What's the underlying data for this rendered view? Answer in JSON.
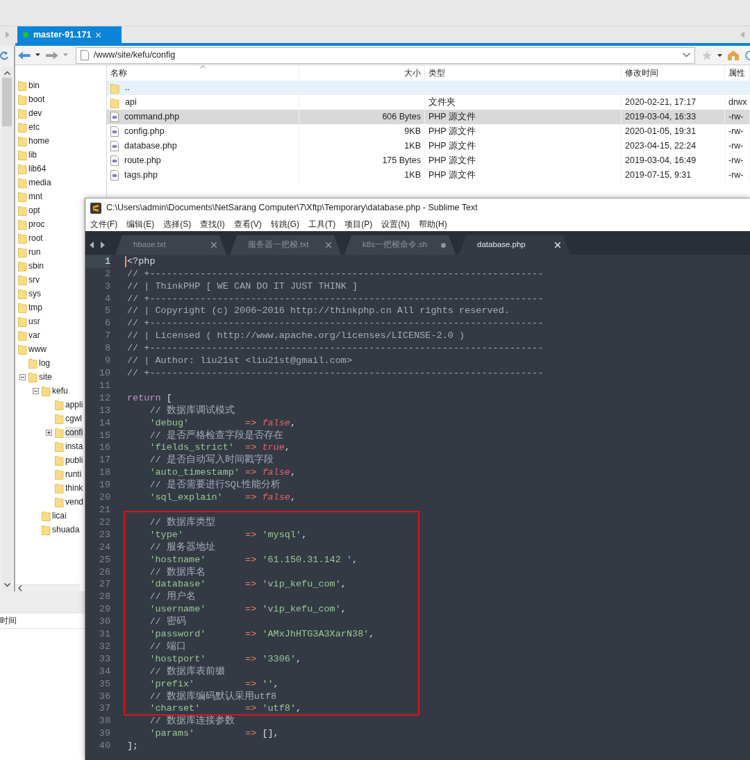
{
  "session_tabs": [
    {
      "label": "master-91.171",
      "connected": true,
      "selected": true
    }
  ],
  "address_bar": {
    "path": "/www/site/kefu/config"
  },
  "tree": [
    {
      "name": "bin",
      "selected": false
    },
    {
      "name": "boot",
      "selected": false
    },
    {
      "name": "dev",
      "selected": false
    },
    {
      "name": "etc",
      "selected": false
    },
    {
      "name": "home",
      "selected": false
    },
    {
      "name": "lib",
      "selected": false
    },
    {
      "name": "lib64",
      "selected": false
    },
    {
      "name": "media",
      "selected": false
    },
    {
      "name": "mnt",
      "selected": false
    },
    {
      "name": "opt",
      "selected": false
    },
    {
      "name": "proc",
      "selected": false
    },
    {
      "name": "root",
      "selected": false
    },
    {
      "name": "run",
      "selected": false
    },
    {
      "name": "sbin",
      "selected": false
    },
    {
      "name": "srv",
      "selected": false
    },
    {
      "name": "sys",
      "selected": false
    },
    {
      "name": "tmp",
      "selected": false
    },
    {
      "name": "usr",
      "selected": false
    },
    {
      "name": "var",
      "selected": false
    },
    {
      "name": "www",
      "selected": false,
      "children": [
        {
          "name": "log",
          "selected": false
        },
        {
          "name": "site",
          "selected": false,
          "expanded": true,
          "children": [
            {
              "name": "kefu",
              "selected": false,
              "expanded": true,
              "children": [
                {
                  "name": "appli",
                  "selected": false
                },
                {
                  "name": "cgwl",
                  "selected": false
                },
                {
                  "name": "confi",
                  "selected": true,
                  "expanded": false
                },
                {
                  "name": "insta",
                  "selected": false
                },
                {
                  "name": "publi",
                  "selected": false
                },
                {
                  "name": "runti",
                  "selected": false
                },
                {
                  "name": "think",
                  "selected": false
                },
                {
                  "name": "vend",
                  "selected": false
                }
              ]
            },
            {
              "name": "licai",
              "selected": false
            },
            {
              "name": "shuada",
              "selected": false
            }
          ]
        }
      ]
    }
  ],
  "file_list": {
    "columns": [
      {
        "label": "名称",
        "sorted": true
      },
      {
        "label": "大小",
        "sorted": false
      },
      {
        "label": "类型",
        "sorted": false
      },
      {
        "label": "修改时间",
        "sorted": false
      },
      {
        "label": "属性",
        "sorted": false
      }
    ],
    "rows": [
      {
        "kind": "folder",
        "name": "..",
        "selected": false,
        "hovered": true
      },
      {
        "kind": "folder",
        "name": "api",
        "type": "文件夹",
        "modified": "2020-02-21, 17:17",
        "attributes": "drwx",
        "selected": false,
        "hovered": false
      },
      {
        "kind": "php",
        "name": "command.php",
        "size": "606 Bytes",
        "type": "PHP 源文件",
        "modified": "2019-03-04, 16:33",
        "attributes": "-rw-",
        "selected": true,
        "hovered": false
      },
      {
        "kind": "php",
        "name": "config.php",
        "size": "9KB",
        "type": "PHP 源文件",
        "modified": "2020-01-05, 19:31",
        "attributes": "-rw-",
        "selected": false,
        "hovered": false
      },
      {
        "kind": "php",
        "name": "database.php",
        "size": "1KB",
        "type": "PHP 源文件",
        "modified": "2023-04-15, 22:24",
        "attributes": "-rw-",
        "selected": false,
        "hovered": false
      },
      {
        "kind": "php",
        "name": "route.php",
        "size": "175 Bytes",
        "type": "PHP 源文件",
        "modified": "2019-03-04, 16:49",
        "attributes": "-rw-",
        "selected": false,
        "hovered": false
      },
      {
        "kind": "php",
        "name": "tags.php",
        "size": "1KB",
        "type": "PHP 源文件",
        "modified": "2019-07-15, 9:31",
        "attributes": "-rw-",
        "selected": false,
        "hovered": false
      }
    ]
  },
  "bottom_panel": {
    "column": "时间"
  },
  "editor": {
    "title": "C:\\Users\\admin\\Documents\\NetSarang Computer\\7\\Xftp\\Temporary\\database.php - Sublime Text",
    "menu": [
      "文件(F)",
      "编辑(E)",
      "选择(S)",
      "查找(I)",
      "查看(V)",
      "转跳(G)",
      "工具(T)",
      "项目(P)",
      "设置(N)",
      "帮助(H)"
    ],
    "tabs": [
      {
        "label": "hbase.txt",
        "selected": false,
        "modified": false
      },
      {
        "label": "服务器一把梭.txt",
        "selected": false,
        "modified": false
      },
      {
        "label": "k8s一把梭命令.sh",
        "selected": false,
        "modified": true
      },
      {
        "label": "database.php",
        "selected": true,
        "modified": false
      }
    ],
    "lines": [
      {
        "number": "1",
        "current": true,
        "boxed": false,
        "indented": false,
        "tokens": [
          {
            "kind": "tag",
            "text": "<?php"
          }
        ]
      },
      {
        "number": "2",
        "current": false,
        "boxed": false,
        "indented": false,
        "tokens": [
          {
            "kind": "comment",
            "text": "// +----------------------------------------------------------------------"
          }
        ]
      },
      {
        "number": "3",
        "current": false,
        "boxed": false,
        "indented": false,
        "tokens": [
          {
            "kind": "comment",
            "text": "// | ThinkPHP [ WE CAN DO IT JUST THINK ]"
          }
        ]
      },
      {
        "number": "4",
        "current": false,
        "boxed": false,
        "indented": false,
        "tokens": [
          {
            "kind": "comment",
            "text": "// +----------------------------------------------------------------------"
          }
        ]
      },
      {
        "number": "5",
        "current": false,
        "boxed": false,
        "indented": false,
        "tokens": [
          {
            "kind": "comment",
            "text": "// | Copyright (c) 2006~2016 http://thinkphp.cn All rights reserved."
          }
        ]
      },
      {
        "number": "6",
        "current": false,
        "boxed": false,
        "indented": false,
        "tokens": [
          {
            "kind": "comment",
            "text": "// +----------------------------------------------------------------------"
          }
        ]
      },
      {
        "number": "7",
        "current": false,
        "boxed": false,
        "indented": false,
        "tokens": [
          {
            "kind": "comment",
            "text": "// | Licensed ( http://www.apache.org/licenses/LICENSE-2.0 )"
          }
        ]
      },
      {
        "number": "8",
        "current": false,
        "boxed": false,
        "indented": false,
        "tokens": [
          {
            "kind": "comment",
            "text": "// +----------------------------------------------------------------------"
          }
        ]
      },
      {
        "number": "9",
        "current": false,
        "boxed": false,
        "indented": false,
        "tokens": [
          {
            "kind": "comment",
            "text": "// | Author: liu21st <liu21st@gmail.com>"
          }
        ]
      },
      {
        "number": "10",
        "current": false,
        "boxed": false,
        "indented": false,
        "tokens": [
          {
            "kind": "comment",
            "text": "// +----------------------------------------------------------------------"
          }
        ]
      },
      {
        "number": "11",
        "current": false,
        "boxed": false
      },
      {
        "number": "12",
        "current": false,
        "boxed": false,
        "indented": false,
        "tokens": [
          {
            "kind": "keyword",
            "text": "return"
          },
          {
            "kind": "plain",
            "text": " ["
          }
        ]
      },
      {
        "number": "13",
        "current": false,
        "boxed": false,
        "indented": true,
        "tokens": [
          {
            "kind": "comment",
            "text": "// 数据库调试模式"
          }
        ]
      },
      {
        "number": "14",
        "current": false,
        "boxed": false,
        "indented": true,
        "tokens": [
          {
            "kind": "key",
            "text": "'debug'"
          },
          {
            "kind": "operator",
            "text": "=>"
          },
          {
            "kind": "constant",
            "text": "false"
          },
          {
            "kind": "plain",
            "text": ","
          }
        ]
      },
      {
        "number": "15",
        "current": false,
        "boxed": false,
        "indented": true,
        "tokens": [
          {
            "kind": "comment",
            "text": "// 是否严格检查字段是否存在"
          }
        ]
      },
      {
        "number": "16",
        "current": false,
        "boxed": false,
        "indented": true,
        "tokens": [
          {
            "kind": "key",
            "text": "'fields_strict'"
          },
          {
            "kind": "operator",
            "text": "=>"
          },
          {
            "kind": "constant",
            "text": "true"
          },
          {
            "kind": "plain",
            "text": ","
          }
        ]
      },
      {
        "number": "17",
        "current": false,
        "boxed": false,
        "indented": true,
        "tokens": [
          {
            "kind": "comment",
            "text": "// 是否自动写入时间戳字段"
          }
        ]
      },
      {
        "number": "18",
        "current": false,
        "boxed": false,
        "indented": true,
        "tokens": [
          {
            "kind": "key",
            "text": "'auto_timestamp'"
          },
          {
            "kind": "operator",
            "text": "=>"
          },
          {
            "kind": "constant",
            "text": "false"
          },
          {
            "kind": "plain",
            "text": ","
          }
        ]
      },
      {
        "number": "19",
        "current": false,
        "boxed": false,
        "indented": true,
        "tokens": [
          {
            "kind": "comment",
            "text": "// 是否需要进行SQL性能分析"
          }
        ]
      },
      {
        "number": "20",
        "current": false,
        "boxed": false,
        "indented": true,
        "tokens": [
          {
            "kind": "key",
            "text": "'sql_explain'"
          },
          {
            "kind": "operator",
            "text": "=>"
          },
          {
            "kind": "constant",
            "text": "false"
          },
          {
            "kind": "plain",
            "text": ","
          }
        ]
      },
      {
        "number": "21",
        "current": false,
        "boxed": false
      },
      {
        "number": "22",
        "current": false,
        "boxed": true,
        "indented": true,
        "tokens": [
          {
            "kind": "comment",
            "text": "// 数据库类型"
          }
        ]
      },
      {
        "number": "23",
        "current": false,
        "boxed": true,
        "indented": true,
        "tokens": [
          {
            "kind": "key",
            "text": "'type'"
          },
          {
            "kind": "operator",
            "text": "=>"
          },
          {
            "kind": "string",
            "text": "'mysql'"
          },
          {
            "kind": "plain",
            "text": ","
          }
        ]
      },
      {
        "number": "24",
        "current": false,
        "boxed": true,
        "indented": true,
        "tokens": [
          {
            "kind": "comment",
            "text": "// 服务器地址"
          }
        ]
      },
      {
        "number": "25",
        "current": false,
        "boxed": true,
        "indented": true,
        "tokens": [
          {
            "kind": "key",
            "text": "'hostname'"
          },
          {
            "kind": "operator",
            "text": "=>"
          },
          {
            "kind": "string",
            "text": "'61.150.31.142 '"
          },
          {
            "kind": "plain",
            "text": ","
          }
        ]
      },
      {
        "number": "26",
        "current": false,
        "boxed": true,
        "indented": true,
        "tokens": [
          {
            "kind": "comment",
            "text": "// 数据库名"
          }
        ]
      },
      {
        "number": "27",
        "current": false,
        "boxed": true,
        "indented": true,
        "tokens": [
          {
            "kind": "key",
            "text": "'database'"
          },
          {
            "kind": "operator",
            "text": "=>"
          },
          {
            "kind": "string",
            "text": "'vip_kefu_com'"
          },
          {
            "kind": "plain",
            "text": ","
          }
        ]
      },
      {
        "number": "28",
        "current": false,
        "boxed": true,
        "indented": true,
        "tokens": [
          {
            "kind": "comment",
            "text": "// 用户名"
          }
        ]
      },
      {
        "number": "29",
        "current": false,
        "boxed": true,
        "indented": true,
        "tokens": [
          {
            "kind": "key",
            "text": "'username'"
          },
          {
            "kind": "operator",
            "text": "=>"
          },
          {
            "kind": "string",
            "text": "'vip_kefu_com'"
          },
          {
            "kind": "plain",
            "text": ","
          }
        ]
      },
      {
        "number": "30",
        "current": false,
        "boxed": true,
        "indented": true,
        "tokens": [
          {
            "kind": "comment",
            "text": "// 密码"
          }
        ]
      },
      {
        "number": "31",
        "current": false,
        "boxed": true,
        "indented": true,
        "tokens": [
          {
            "kind": "key",
            "text": "'password'"
          },
          {
            "kind": "operator",
            "text": "=>"
          },
          {
            "kind": "string",
            "text": "'AMxJhHTG3A3XarN38'"
          },
          {
            "kind": "plain",
            "text": ","
          }
        ]
      },
      {
        "number": "32",
        "current": false,
        "boxed": true,
        "indented": true,
        "tokens": [
          {
            "kind": "comment",
            "text": "// 端口"
          }
        ]
      },
      {
        "number": "33",
        "current": false,
        "boxed": true,
        "indented": true,
        "tokens": [
          {
            "kind": "key",
            "text": "'hostport'"
          },
          {
            "kind": "operator",
            "text": "=>"
          },
          {
            "kind": "string",
            "text": "'3306'"
          },
          {
            "kind": "plain",
            "text": ","
          }
        ]
      },
      {
        "number": "34",
        "current": false,
        "boxed": true,
        "indented": true,
        "tokens": [
          {
            "kind": "comment",
            "text": "// 数据库表前缀"
          }
        ]
      },
      {
        "number": "35",
        "current": false,
        "boxed": true,
        "indented": true,
        "tokens": [
          {
            "kind": "key",
            "text": "'prefix'"
          },
          {
            "kind": "operator",
            "text": "=>"
          },
          {
            "kind": "string",
            "text": "''"
          },
          {
            "kind": "plain",
            "text": ","
          }
        ]
      },
      {
        "number": "36",
        "current": false,
        "boxed": true,
        "indented": true,
        "tokens": [
          {
            "kind": "comment",
            "text": "// 数据库编码默认采用utf8"
          }
        ]
      },
      {
        "number": "37",
        "current": false,
        "boxed": true,
        "indented": true,
        "tokens": [
          {
            "kind": "key",
            "text": "'charset'"
          },
          {
            "kind": "operator",
            "text": "=>"
          },
          {
            "kind": "string",
            "text": "'utf8'"
          },
          {
            "kind": "plain",
            "text": ","
          }
        ]
      },
      {
        "number": "38",
        "current": false,
        "boxed": false,
        "indented": true,
        "tokens": [
          {
            "kind": "comment",
            "text": "// 数据库连接参数"
          }
        ]
      },
      {
        "number": "39",
        "current": false,
        "boxed": false,
        "indented": true,
        "tokens": [
          {
            "kind": "key",
            "text": "'params'"
          },
          {
            "kind": "operator",
            "text": "=>"
          },
          {
            "kind": "plain",
            "text": "[],"
          }
        ]
      },
      {
        "number": "40",
        "current": false,
        "boxed": false,
        "indented": false,
        "tokens": [
          {
            "kind": "plain",
            "text": "];"
          }
        ]
      }
    ]
  }
}
